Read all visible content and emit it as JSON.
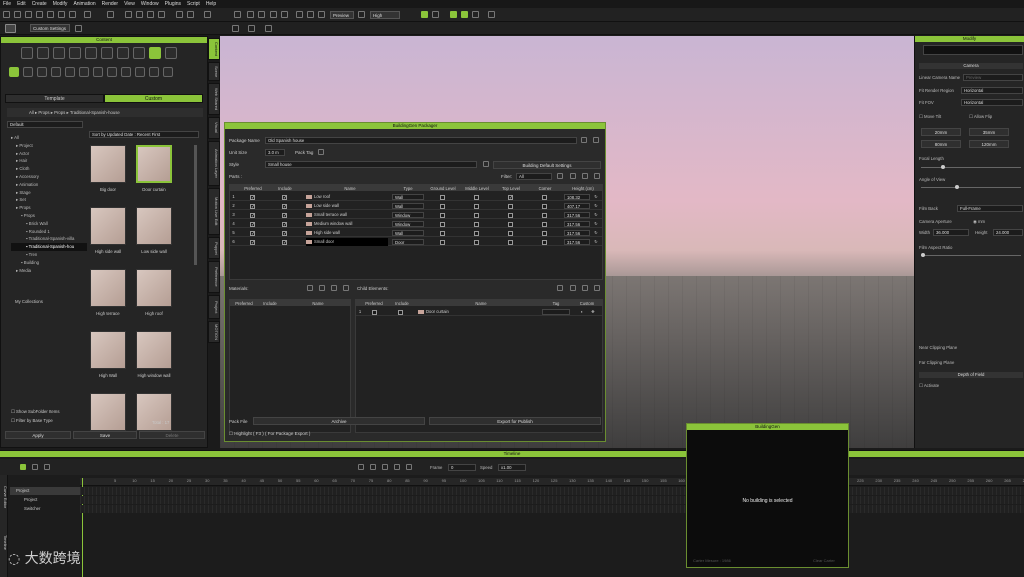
{
  "menu": [
    "File",
    "Edit",
    "Create",
    "Modify",
    "Animation",
    "Render",
    "View",
    "Window",
    "Plugins",
    "Script",
    "Help"
  ],
  "toolbar": {
    "workspace": "Custom Settings",
    "preview": "Preview",
    "quality": "High"
  },
  "content": {
    "title": "Content",
    "tabs": [
      "Template",
      "Custom"
    ],
    "filter": "Default",
    "breadcrumb": [
      "All",
      "Props",
      "Props",
      "Traditional-Spanish-house"
    ],
    "sort": "Sort by Updated Date : Recent First",
    "tree": [
      {
        "label": "All",
        "level": 0
      },
      {
        "label": "Project",
        "level": 1
      },
      {
        "label": "Actor",
        "level": 1
      },
      {
        "label": "Hair",
        "level": 1
      },
      {
        "label": "Cloth",
        "level": 1
      },
      {
        "label": "Accessory",
        "level": 1
      },
      {
        "label": "Animation",
        "level": 1
      },
      {
        "label": "Stage",
        "level": 1
      },
      {
        "label": "Set",
        "level": 1
      },
      {
        "label": "Props",
        "level": 1
      },
      {
        "label": "Props",
        "level": 2
      },
      {
        "label": "Brick Wall",
        "level": 3
      },
      {
        "label": "Rounded 1",
        "level": 3
      },
      {
        "label": "Traditional-Spanish-villa",
        "level": 3
      },
      {
        "label": "Traditional-Spanish-hou",
        "level": 3,
        "selected": true
      },
      {
        "label": "Tren",
        "level": 3
      },
      {
        "label": "Building",
        "level": 2
      },
      {
        "label": "Media",
        "level": 1
      }
    ],
    "my_collections": "My Collections",
    "thumbs": [
      "Big door",
      "Door curtain",
      "High side wall",
      "Low side wall",
      "High terrace",
      "High roof",
      "High Wall",
      "High window wall",
      "",
      ""
    ],
    "show_subfolder": "Show SubFolder Items",
    "filter_base": "Filter by Base Type",
    "total": "Total : 17",
    "buttons": [
      "Apply",
      "Save",
      "Delete"
    ]
  },
  "side_tabs": [
    "Content",
    "Scene",
    "Web Shared",
    "Visual",
    "Animation Layer",
    "Motion Live Edit",
    "Puppet",
    "Preference",
    "Project",
    "MOTION"
  ],
  "packager": {
    "title": "BuildingGen Packager",
    "package_name_label": "Package Name",
    "package_name": "Old Spanish house",
    "unit_size_label": "Unit Size",
    "unit_size": "3.0 m",
    "pack_tag_label": "Pack Tag",
    "style_label": "Style",
    "style": "Small house",
    "default_settings": "Building Default Settings",
    "parts_label": "Parts :",
    "filter_label": "Filter:",
    "filter_value": "All",
    "columns": [
      "Preferred",
      "Include",
      "Name",
      "Type",
      "Ground Level",
      "Middle Level",
      "Top Level",
      "Corner",
      "Height (cm)"
    ],
    "rows": [
      {
        "n": "1",
        "name": "Low roof",
        "type": "Wall",
        "height": "108.32",
        "preferred": true,
        "include": true,
        "ground": false,
        "middle": false,
        "top": true,
        "corner": false
      },
      {
        "n": "2",
        "name": "Low side wall",
        "type": "Wall",
        "height": "407.17",
        "preferred": true,
        "include": true,
        "ground": false,
        "middle": false,
        "top": false,
        "corner": false
      },
      {
        "n": "3",
        "name": "Small terrace wall",
        "type": "Window",
        "height": "317.56",
        "preferred": true,
        "include": true,
        "ground": false,
        "middle": false,
        "top": false,
        "corner": false
      },
      {
        "n": "4",
        "name": "Medium window wall",
        "type": "Window",
        "height": "317.56",
        "preferred": true,
        "include": true,
        "ground": false,
        "middle": false,
        "top": false,
        "corner": false
      },
      {
        "n": "5",
        "name": "High side wall",
        "type": "Wall",
        "height": "317.56",
        "preferred": true,
        "include": true,
        "ground": false,
        "middle": false,
        "top": false,
        "corner": false
      },
      {
        "n": "6",
        "name": "Small door",
        "type": "Door",
        "height": "317.56",
        "preferred": true,
        "include": true,
        "ground": false,
        "middle": false,
        "top": false,
        "corner": false
      }
    ],
    "materials_label": "Materials:",
    "mat_columns": [
      "Preferred",
      "Include",
      "Name"
    ],
    "child_label": "Child Elements:",
    "child_columns": [
      "Preferred",
      "Include",
      "Name",
      "Tag",
      "Custom"
    ],
    "child_rows": [
      {
        "n": "1",
        "name": "Door curtain"
      }
    ],
    "pack_file_label": "Pack File",
    "archive": "Archive",
    "export": "Export for Publish",
    "highlight": "Highlight ( F3 ) ( For Package Export )"
  },
  "modify": {
    "title": "Modify",
    "camera_section": "Camera",
    "linear_camera": "Linear Camera Name",
    "linear_camera_value": "Preview",
    "fit_region_label": "Fit Render Region",
    "fit_region": "Horizontal",
    "fit_fov_label": "Fit FOV",
    "fit_fov": "Horizontal",
    "move_tilt": "Move Tilt",
    "allow_flip": "Allow Flip",
    "lens": [
      "20mm",
      "35mm",
      "80mm",
      "120mm"
    ],
    "focal_length": "Focal Length",
    "angle_of_view": "Angle of View",
    "film_back": "Film Back",
    "film_back_value": "Full-Frame",
    "aperture": "Camera Aperture",
    "mm": "mm",
    "width_label": "Width",
    "width": "36.000",
    "height_label": "Height",
    "height": "24.000",
    "aspect": "Film Aspect Ratio",
    "near_clip": "Near Clipping Plane",
    "far_clip": "Far Clipping Plane",
    "dof": "Depth of Field",
    "activate": "Activate"
  },
  "timeline": {
    "title": "Timeline",
    "frame_label": "Frame",
    "frame": "0",
    "speed_label": "Speed",
    "speed": "x1.00",
    "tracks": [
      "Project",
      "Project",
      "Switcher"
    ],
    "ticks": [
      "5",
      "10",
      "15",
      "20",
      "25",
      "30",
      "35",
      "40",
      "45",
      "50",
      "55",
      "60",
      "65",
      "70",
      "75",
      "80",
      "85",
      "90",
      "95",
      "100",
      "105",
      "110",
      "115",
      "120",
      "125",
      "130",
      "135",
      "140",
      "145",
      "150",
      "155",
      "160",
      "165",
      "170",
      "225",
      "230",
      "235",
      "240",
      "245",
      "250",
      "255",
      "260",
      "265",
      "270",
      "275"
    ],
    "side_tabs": [
      "Curve Editor",
      "Timeline"
    ]
  },
  "buildinggen": {
    "title": "BuildingGen",
    "message": "No building is selected",
    "carte": "Carter Mesure : 1986",
    "clear": "Clear Carter"
  },
  "watermark": "大数跨境"
}
